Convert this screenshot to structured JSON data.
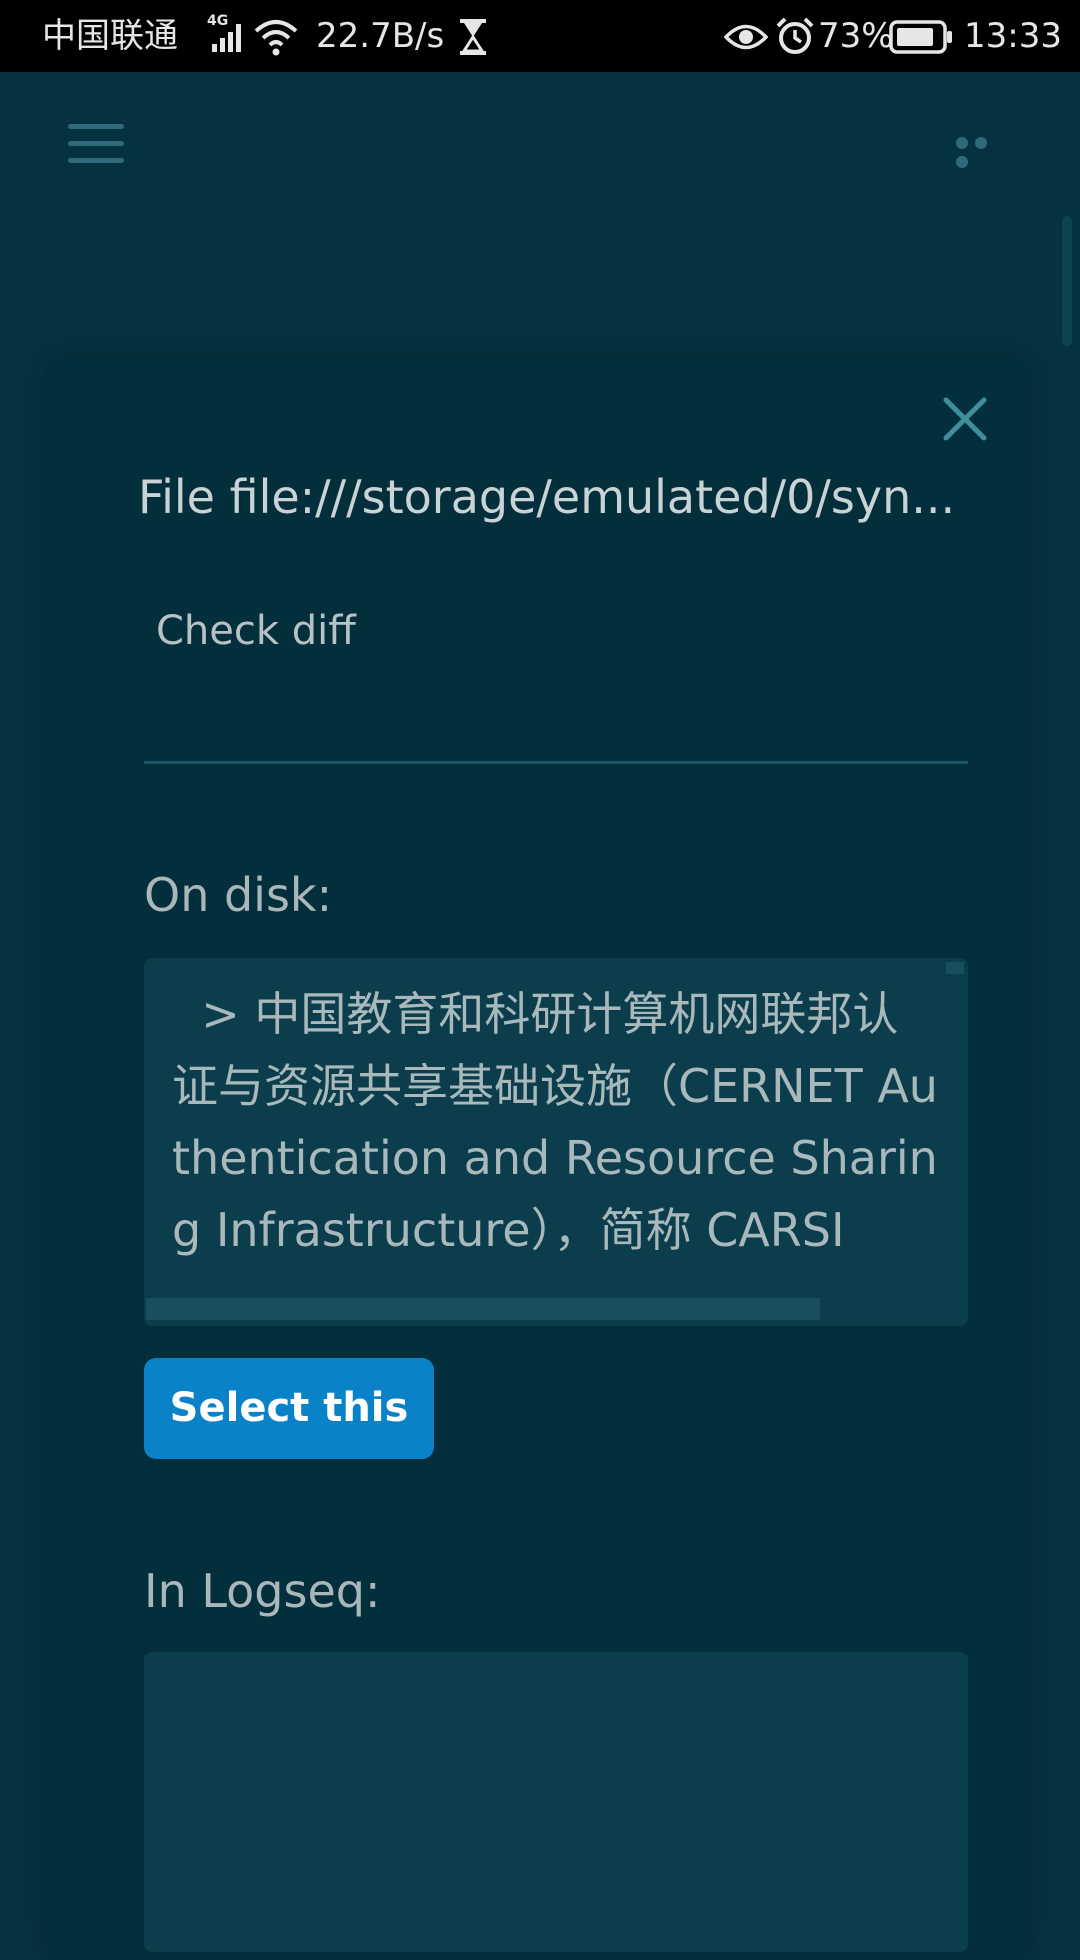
{
  "status_bar": {
    "carrier": "中国联通",
    "network_type": "4G",
    "speed": "22.7B/s",
    "battery_percent": "73%",
    "time": "13:33",
    "icons": [
      "signal-icon",
      "wifi-icon",
      "hourglass-icon",
      "eye-icon",
      "alarm-icon",
      "battery-icon"
    ]
  },
  "app_bar": {
    "left_icon": "hamburger-menu-icon",
    "right_icon": "more-dots-icon"
  },
  "dialog": {
    "title": "File file:///storage/emulated/0/syn...",
    "check_diff_label": "Check diff",
    "on_disk_label": "On disk:",
    "on_disk_content": "  > 中国教育和科研计算机网联邦认证与资源共享基础设施（CERNET Authentication and Resource Sharing Infrastructure），简称 CARSI",
    "select_button_label": "Select this",
    "in_logseq_label": "In Logseq:",
    "in_logseq_content": ""
  },
  "colors": {
    "background": "#053241",
    "dialog": "#032f3c",
    "textbox": "#0b3d4c",
    "accent_button": "#0a82c7"
  }
}
